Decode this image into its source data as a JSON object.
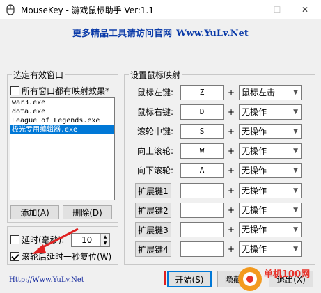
{
  "window": {
    "title": "MouseKey - 游戏鼠标助手 Ver:1.1",
    "min_glyph": "—",
    "max_glyph": "☐",
    "close_glyph": "✕"
  },
  "banner": {
    "text": "更多精品工具请访问官网",
    "site": "Www.YuLv.Net"
  },
  "left_panel": {
    "group_title": "选定有效窗口",
    "all_windows_checkbox": "所有窗口都有映射效果*",
    "all_windows_checked": false,
    "windows": [
      {
        "name": "war3.exe",
        "selected": false
      },
      {
        "name": "dota.exe",
        "selected": false
      },
      {
        "name": "League of Legends.exe",
        "selected": false
      },
      {
        "name": "极光专用编辑器.exe",
        "selected": true
      }
    ],
    "add_button": "添加(A)",
    "delete_button": "删除(D)"
  },
  "options": {
    "delay_label": "延时(毫秒):",
    "delay_checked": false,
    "delay_value": "10",
    "reset_label": "滚轮后延时一秒复位(W)",
    "reset_checked": true
  },
  "mapping": {
    "group_title": "设置鼠标映射",
    "plus": "+",
    "rows": [
      {
        "label": "鼠标左键:",
        "key": "Z",
        "action": "鼠标左击",
        "is_ext": false
      },
      {
        "label": "鼠标右键:",
        "key": "D",
        "action": "无操作",
        "is_ext": false
      },
      {
        "label": "滚轮中键:",
        "key": "S",
        "action": "无操作",
        "is_ext": false
      },
      {
        "label": "向上滚轮:",
        "key": "W",
        "action": "无操作",
        "is_ext": false
      },
      {
        "label": "向下滚轮:",
        "key": "A",
        "action": "无操作",
        "is_ext": false
      },
      {
        "label": "扩展键1",
        "key": "",
        "action": "无操作",
        "is_ext": true
      },
      {
        "label": "扩展键2",
        "key": "",
        "action": "无操作",
        "is_ext": true
      },
      {
        "label": "扩展键3",
        "key": "",
        "action": "无操作",
        "is_ext": true
      },
      {
        "label": "扩展键4",
        "key": "",
        "action": "无操作",
        "is_ext": true
      }
    ]
  },
  "footer": {
    "link": "Http://Www.YuLv.Net",
    "start_button": "开始(S)",
    "hide_button": "隐藏",
    "exit_button": "退出(X)"
  },
  "watermark": {
    "text": "单机100网"
  },
  "colors": {
    "banner": "#0a3aa8",
    "selection": "#0078d7",
    "link": "#1a2ea0",
    "marker": "#e02020",
    "watermark": "#e8322a"
  }
}
